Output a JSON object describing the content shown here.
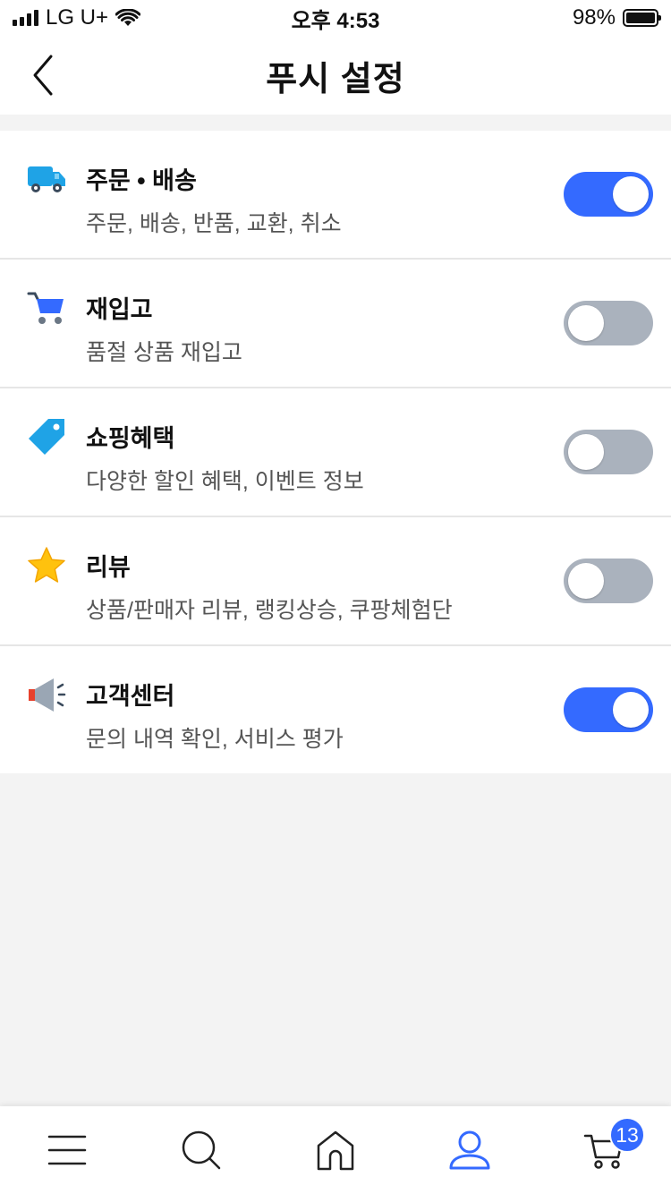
{
  "status_bar": {
    "carrier": "LG U+",
    "time": "오후 4:53",
    "battery": "98%"
  },
  "header": {
    "title": "푸시 설정",
    "back_icon": "chevron-left-icon"
  },
  "settings": [
    {
      "title": "주문 • 배송",
      "description": "주문, 배송, 반품, 교환, 취소",
      "icon": "truck-icon",
      "enabled": true
    },
    {
      "title": "재입고",
      "description": "품절 상품 재입고",
      "icon": "cart-icon",
      "enabled": false
    },
    {
      "title": "쇼핑혜택",
      "description": "다양한 할인 혜택, 이벤트 정보",
      "icon": "tag-icon",
      "enabled": false
    },
    {
      "title": "리뷰",
      "description": "상품/판매자 리뷰, 랭킹상승, 쿠팡체험단",
      "icon": "star-icon",
      "enabled": false
    },
    {
      "title": "고객센터",
      "description": "문의 내역 확인, 서비스 평가",
      "icon": "megaphone-icon",
      "enabled": true
    }
  ],
  "tab_bar": {
    "items": [
      "menu-icon",
      "search-icon",
      "home-icon",
      "user-icon",
      "cart-icon"
    ],
    "active_index": 3,
    "cart_badge": "13"
  },
  "colors": {
    "accent": "#346aff",
    "toggle_off": "#aab2bd",
    "background": "#f3f3f3"
  }
}
